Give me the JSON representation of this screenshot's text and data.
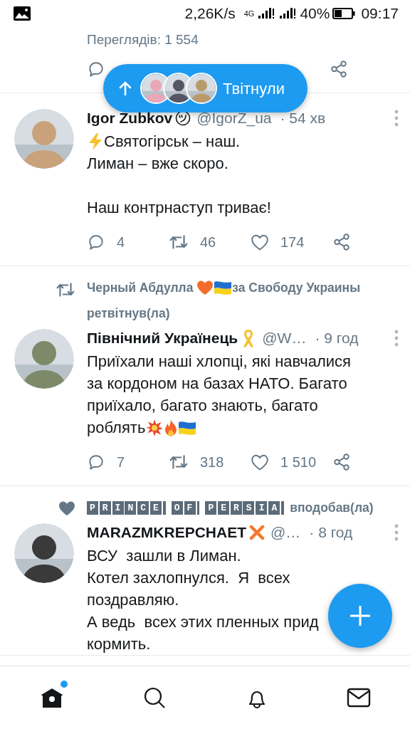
{
  "status_bar": {
    "speed": "2,26K/s",
    "network": "4G",
    "battery": "40%",
    "time": "09:17"
  },
  "previous_tweet": {
    "views": "Переглядів: 1 554"
  },
  "new_tweets_pill": {
    "label": "Твітнули"
  },
  "tweets": [
    {
      "name": "Igor Zubkov",
      "badge": {
        "kind": "smiley"
      },
      "handle": "@IgorZ_ua",
      "time": "· 54 хв",
      "paragraphs": [
        [
          [
            {
              "kind": "lightning"
            },
            {
              "kind": "text",
              "text": "Святогірськ – наш."
            }
          ],
          [
            {
              "kind": "text",
              "text": "Лиман – вже скоро."
            }
          ]
        ],
        [
          [
            {
              "kind": "text",
              "text": "Наш контрнаступ триває!"
            }
          ]
        ]
      ],
      "actions": {
        "replies": "4",
        "retweets": "46",
        "likes": "174"
      }
    },
    {
      "context": {
        "kind": "retweet",
        "segments": [
          {
            "kind": "text",
            "text": "Черный Абдулла "
          },
          {
            "kind": "heart"
          },
          {
            "kind": "flag"
          },
          {
            "kind": "text",
            "text": "за Свободу Украины"
          }
        ],
        "action": "ретвітнув(ла)"
      },
      "name": "Північний Українець",
      "badge": {
        "kind": "ribbon"
      },
      "handle": "@W…",
      "time": "· 9 год",
      "paragraphs": [
        [
          [
            {
              "kind": "text",
              "text": "Приїхали наші хлопці, які навчалися"
            }
          ],
          [
            {
              "kind": "text",
              "text": "за кордоном на базах НАТО. Багато"
            }
          ],
          [
            {
              "kind": "text",
              "text": "приїхало, багато знають, багато"
            }
          ],
          [
            {
              "kind": "text",
              "text": "роблять"
            },
            {
              "kind": "boom"
            },
            {
              "kind": "fire"
            },
            {
              "kind": "flag"
            }
          ]
        ]
      ],
      "actions": {
        "replies": "7",
        "retweets": "318",
        "likes": "1 510"
      }
    },
    {
      "context": {
        "kind": "like",
        "segments": [
          {
            "kind": "boxed",
            "text": "PRINCE"
          },
          {
            "kind": "boxed",
            "text": "OF"
          },
          {
            "kind": "boxed",
            "text": "PERSIA"
          }
        ],
        "action": "вподобав(ла)"
      },
      "name": "MARAZMKREPCHAET",
      "badge": {
        "kind": "cross"
      },
      "handle": "@…",
      "time": "· 8 год",
      "paragraphs": [
        [
          [
            {
              "kind": "text",
              "text": "ВСУ  зашли в Лиман."
            }
          ],
          [
            {
              "kind": "text",
              "text": "Котел захлопнулся.  Я  всех"
            }
          ],
          [
            {
              "kind": "text",
              "text": "поздравляю."
            }
          ],
          [
            {
              "kind": "text",
              "text": "А ведь  всех этих пленных прид"
            }
          ],
          [
            {
              "kind": "text",
              "text": "кормить."
            }
          ]
        ]
      ]
    }
  ],
  "nav": [
    {
      "kind": "home",
      "selected": true,
      "new": true
    },
    {
      "kind": "search",
      "selected": false,
      "new": false
    },
    {
      "kind": "bell",
      "selected": false,
      "new": false
    },
    {
      "kind": "mail",
      "selected": false,
      "new": false
    }
  ]
}
